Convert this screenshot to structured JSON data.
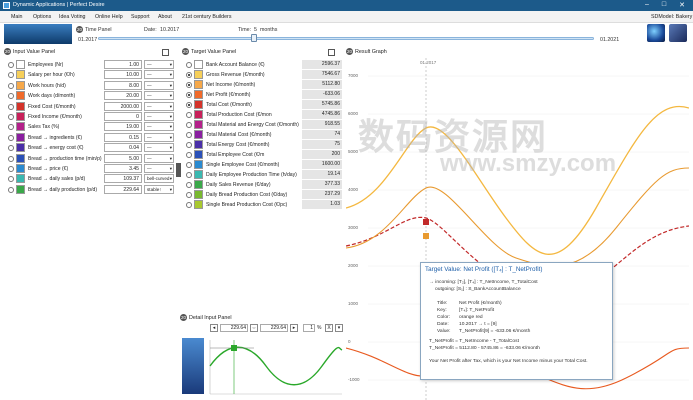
{
  "window": {
    "title": "Dynamic Applications | Perfect Desire",
    "controls": [
      "–",
      "□",
      "✕"
    ]
  },
  "menu": [
    "Main",
    "Options",
    "Idea Voting",
    "Online Help",
    "Support",
    "About",
    "21st century Builders"
  ],
  "menu_right": "SDModel: Bakery",
  "time_panel": {
    "badge": "20",
    "label": "Time Panel",
    "date_label": "Date:",
    "date_value": "10.2017",
    "time_label": "Time:",
    "time_value": "5",
    "time_unit": "months",
    "start": "01.2017",
    "end": "01.2021"
  },
  "input_panel": {
    "badge": "20",
    "title": "Input Value Panel",
    "rows": [
      {
        "sym": "I₁",
        "label": "Employees (Nr)",
        "value": "1.00",
        "unit": "—",
        "color": "#ffffff"
      },
      {
        "sym": "I₂",
        "label": "Salary per hour (€/h)",
        "value": "10.00",
        "unit": "—",
        "color": "#f6cf5a"
      },
      {
        "sym": "I₃",
        "label": "Work hours (h/d)",
        "value": "8.00",
        "unit": "—",
        "color": "#f6a84a"
      },
      {
        "sym": "I₄",
        "label": "Work days (d/month)",
        "value": "20.00",
        "unit": "—",
        "color": "#f06a2a"
      },
      {
        "sym": "I₅",
        "label": "Fixed Cost (€/month)",
        "value": "2000.00",
        "unit": "—",
        "color": "#d4332a"
      },
      {
        "sym": "I₆",
        "label": "Fixed Income (€/month)",
        "value": "0",
        "unit": "—",
        "color": "#c8205a"
      },
      {
        "sym": "I₇",
        "label": "Sales Tax (%)",
        "value": "19.00",
        "unit": "—",
        "color": "#b4208a"
      },
      {
        "sym": "I₈",
        "label": "Bread → ingredients (€)",
        "value": "0.15",
        "unit": "—",
        "color": "#8a1fa0"
      },
      {
        "sym": "I₉",
        "label": "Bread → energy cost (€)",
        "value": "0.04",
        "unit": "—",
        "color": "#4a2fa8"
      },
      {
        "sym": "I₁₀",
        "label": "Bread → production time (min/p)",
        "value": "5.00",
        "unit": "—",
        "color": "#2a50b8"
      },
      {
        "sym": "I₁₁",
        "label": "Bread → price (€)",
        "value": "3.45",
        "unit": "—",
        "color": "#2a8ad0"
      },
      {
        "sym": "I₁₂",
        "label": "Bread → daily sales (p/d)",
        "value": "109.37",
        "unit": "bell-curved",
        "color": "#3ab8b0"
      },
      {
        "sym": "I₁₃",
        "label": "Bread → daily production (p/d)",
        "value": "229.64",
        "unit": "stable↑",
        "color": "#3aa84a"
      }
    ]
  },
  "target_panel": {
    "badge": "20",
    "title": "Target Value Panel",
    "rows": [
      {
        "sym": "S₁",
        "label": "Bank Account Balance (€)",
        "value": "2596.37",
        "color": "#ffffff",
        "on": false
      },
      {
        "sym": "T₁",
        "label": "Gross Revenue (€/month)",
        "value": "7546.67",
        "color": "#f6cf5a",
        "on": true
      },
      {
        "sym": "T₂",
        "label": "Net Income (€/month)",
        "value": "5112.80",
        "color": "#f6a84a",
        "on": true
      },
      {
        "sym": "T₃",
        "label": "Net Profit (€/month)",
        "value": "-633.06",
        "color": "#f06a2a",
        "on": true
      },
      {
        "sym": "T₄",
        "label": "Total Cost (€/month)",
        "value": "5745.86",
        "color": "#d4332a",
        "on": true
      },
      {
        "sym": "T₅",
        "label": "Total Production Cost (€/mon",
        "value": "4745.86",
        "color": "#c8205a",
        "on": false
      },
      {
        "sym": "T₆",
        "label": "Total Material and Energy Cost (€/month)",
        "value": "918.55",
        "color": "#b4208a",
        "on": false
      },
      {
        "sym": "T₇",
        "label": "Total Material Cost (€/month)",
        "value": "74",
        "color": "#8a1fa0",
        "on": false
      },
      {
        "sym": "T₈",
        "label": "Total Energy Cost (€/month)",
        "value": "75",
        "color": "#4a2fa8",
        "on": false
      },
      {
        "sym": "T₉",
        "label": "Total Employee Cost (€/m",
        "value": "200",
        "color": "#2a50b8",
        "on": false
      },
      {
        "sym": "T₁₀",
        "label": "Single Employee Cost (€/month)",
        "value": "1600.00",
        "color": "#2a8ad0",
        "on": false
      },
      {
        "sym": "T₁₁",
        "label": "Daily Employee Production Time (h/day)",
        "value": "19.14",
        "color": "#3ab8b0",
        "on": false
      },
      {
        "sym": "T₁₂",
        "label": "Daily Sales Revenue (€/day)",
        "value": "377.33",
        "color": "#3aa84a",
        "on": false
      },
      {
        "sym": "T₁₃",
        "label": "Daily Bread Production Cost (€/day)",
        "value": "237.29",
        "color": "#78b830",
        "on": false
      },
      {
        "sym": "T₁₄",
        "label": "Single Bread Production Cost (€/pc)",
        "value": "1.03",
        "color": "#a8c830",
        "on": false
      }
    ]
  },
  "detail_panel": {
    "badge": "20",
    "title": "Detail Input Panel",
    "v1": "229.64",
    "v2": "229.64",
    "pct": "1",
    "pct_unit": "%"
  },
  "graph": {
    "badge": "20",
    "title": "Result Graph",
    "y_ticks": [
      "7000",
      "6000",
      "5000",
      "4000",
      "3000",
      "2000",
      "1000",
      "0",
      "-1000"
    ],
    "marker_date": "10.2017",
    "marker_top": "01.2017"
  },
  "tooltip": {
    "title": "Target Value:  Net Profit   ([T₄] : T_NetProfit)",
    "incoming": "→ incoming:  [T₂], [T₄] :  T_NetIncome,  T_TotalCost",
    "outgoing": "outgoing:  [S₁] :  S_BankAccountBalance",
    "fields": [
      [
        "Title:",
        "Net Profit (€/month)"
      ],
      [
        "Key:",
        "[T₄]: T_NetProfit"
      ],
      [
        "Color:",
        "orange red"
      ],
      [
        "Date:",
        "10.2017  →  t = [9]"
      ],
      [
        "Value:",
        "T_NetProfit[9] = -633.06 €/month"
      ]
    ],
    "formula1": "T_NetProfit  =  T_NetIncome  - T_TotalCost",
    "formula2": "T_NetProfit  =  5112.80 - 5745.86 = -633.06 €/month",
    "description": "Your Net Profit after Tax, which is your Net Income minus your Total Cost."
  },
  "watermark": {
    "line1": "数码资源网",
    "line2": "www.smzy.com"
  }
}
